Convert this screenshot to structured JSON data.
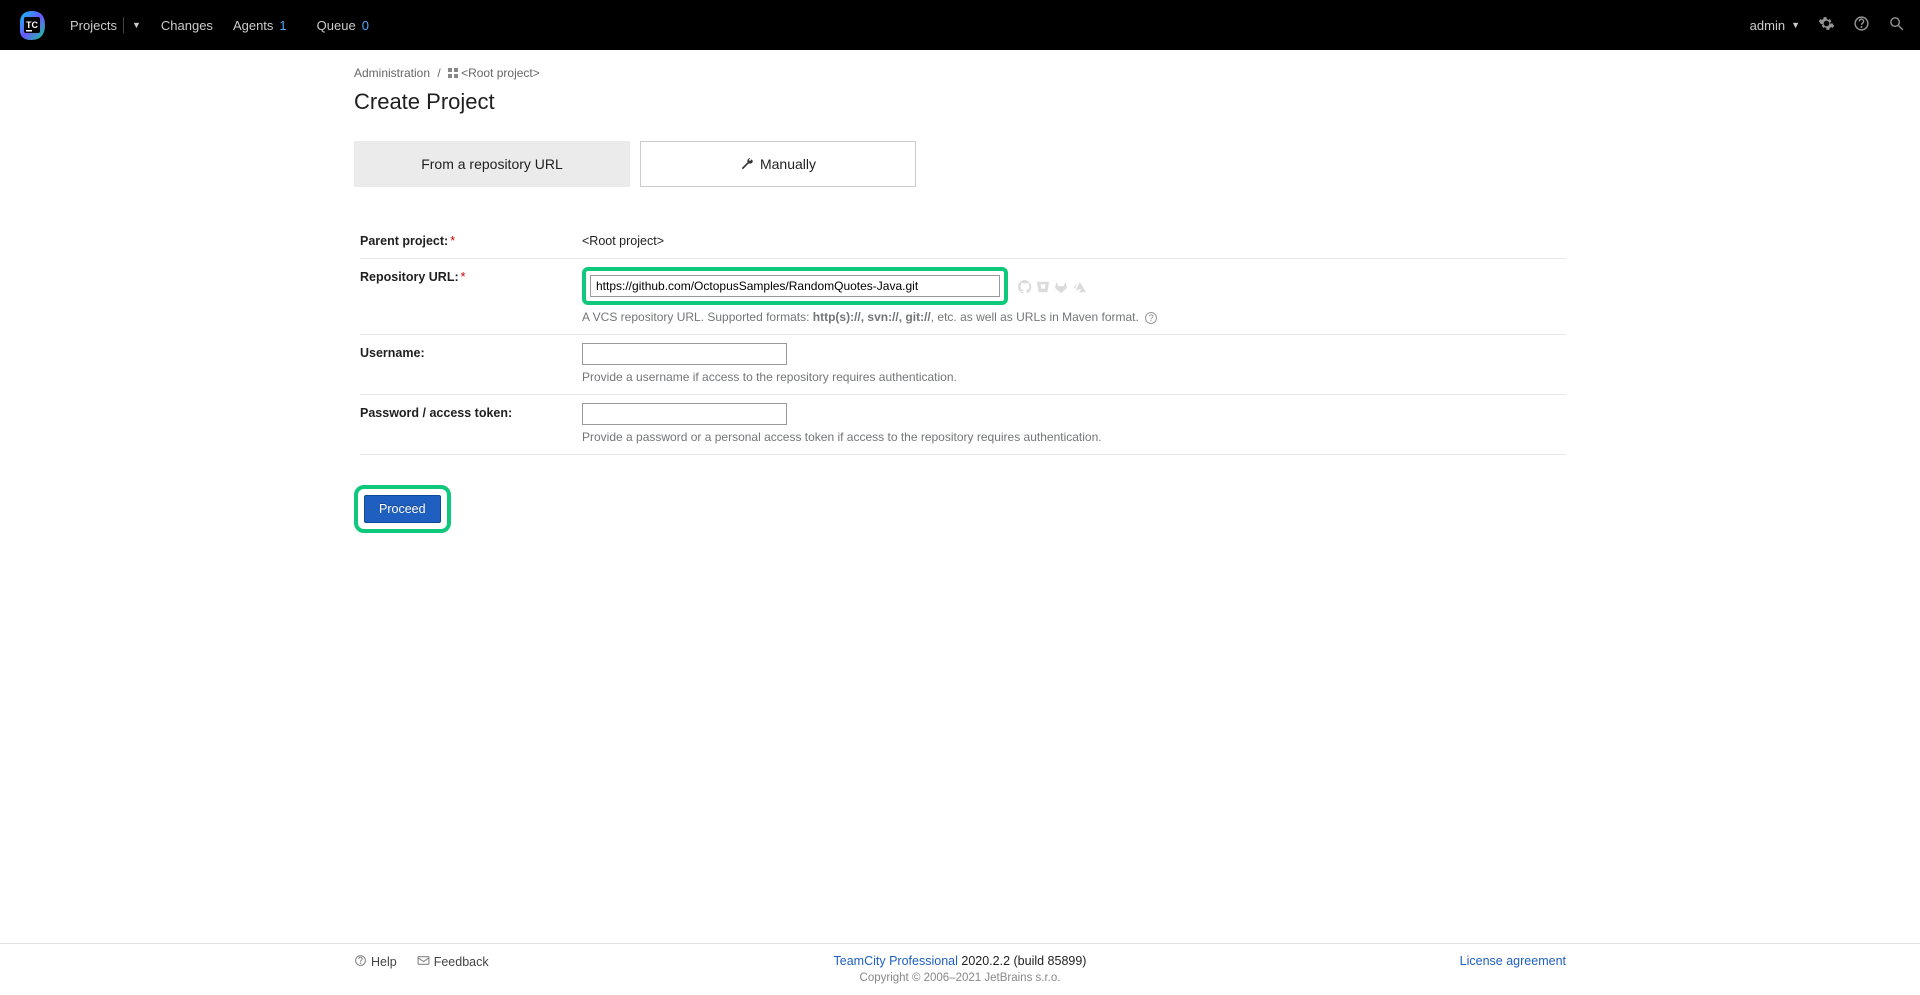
{
  "header": {
    "nav": {
      "projects": "Projects",
      "changes": "Changes",
      "agents": "Agents",
      "agents_count": "1",
      "queue": "Queue",
      "queue_count": "0"
    },
    "user": "admin"
  },
  "breadcrumb": {
    "admin": "Administration",
    "root": "<Root project>"
  },
  "title": "Create Project",
  "tabs": {
    "from_url": "From a repository URL",
    "manually": "Manually"
  },
  "form": {
    "parent_label": "Parent project:",
    "parent_value": "<Root project>",
    "repo_label": "Repository URL:",
    "repo_value": "https://github.com/OctopusSamples/RandomQuotes-Java.git",
    "repo_hint_prefix": "A VCS repository URL. Supported formats: ",
    "repo_hint_bold": "http(s)://, svn://, git://",
    "repo_hint_suffix": ", etc. as well as URLs in Maven format.",
    "user_label": "Username:",
    "user_hint": "Provide a username if access to the repository requires authentication.",
    "pass_label": "Password / access token:",
    "pass_hint": "Provide a password or a personal access token if access to the repository requires authentication.",
    "proceed": "Proceed"
  },
  "footer": {
    "help": "Help",
    "feedback": "Feedback",
    "product": "TeamCity Professional",
    "version": "2020.2.2 (build 85899)",
    "copyright": "Copyright © 2006–2021 JetBrains s.r.o.",
    "license": "License agreement"
  }
}
